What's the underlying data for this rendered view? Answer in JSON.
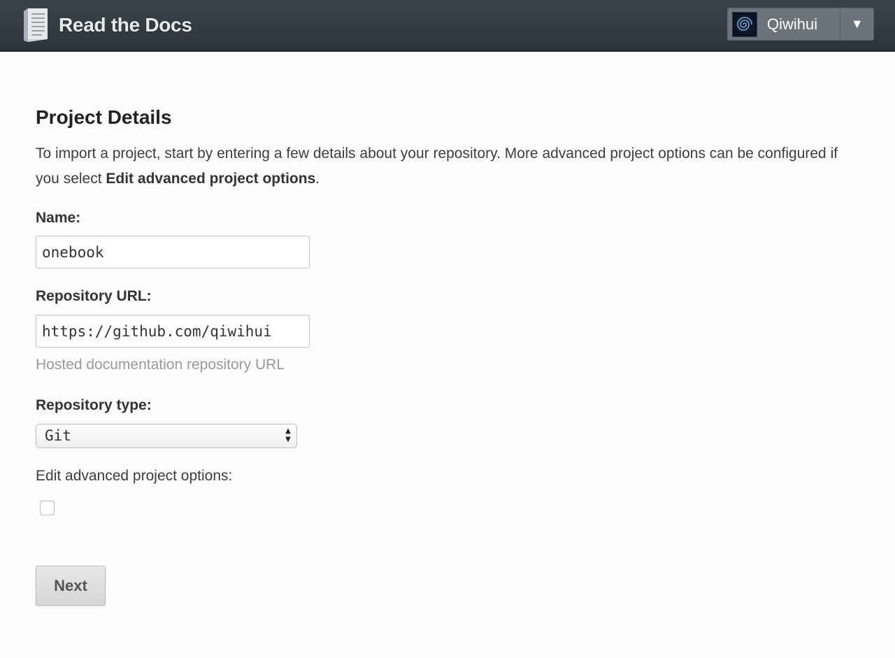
{
  "header": {
    "brand": "Read the Docs",
    "logo_icon": "book-icon",
    "user": {
      "name": "Qiwihui",
      "avatar_icon": "spiral-avatar",
      "menu_toggle": "▼"
    }
  },
  "form": {
    "title": "Project Details",
    "intro_text": "To import a project, start by entering a few details about your repository. More advanced project options can be configured if you select ",
    "intro_bold": "Edit advanced project options",
    "intro_end": ".",
    "name": {
      "label": "Name:",
      "value": "onebook"
    },
    "repo_url": {
      "label": "Repository URL:",
      "value": "https://github.com/qiwihui",
      "help": "Hosted documentation repository URL"
    },
    "repo_type": {
      "label": "Repository type:",
      "selected": "Git"
    },
    "advanced": {
      "label": "Edit advanced project options:",
      "checked": false
    },
    "submit_label": "Next"
  },
  "colors": {
    "header_bg": "#343d44",
    "user_menu_bg": "#6c747b",
    "page_bg": "#fcfcfc",
    "help_text": "#9a9a9a"
  }
}
